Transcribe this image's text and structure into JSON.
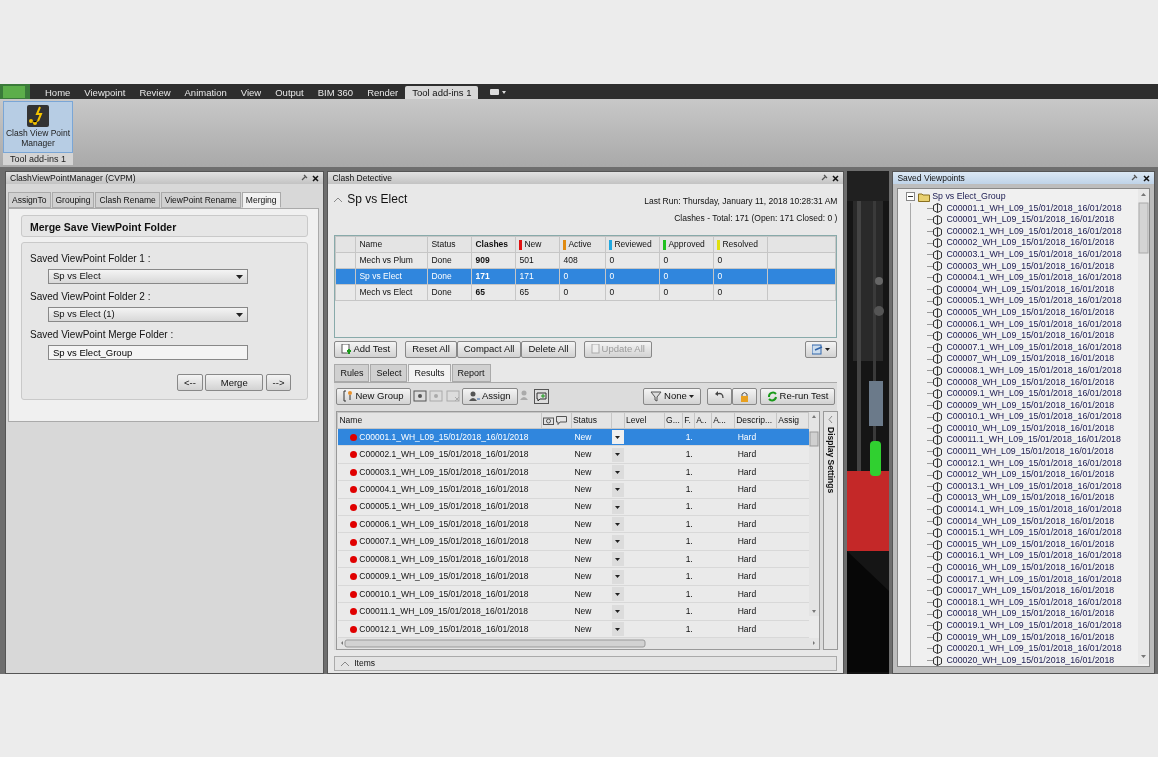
{
  "ribbon": {
    "tabs": [
      {
        "label": "Home",
        "selected": false
      },
      {
        "label": "Viewpoint",
        "selected": false
      },
      {
        "label": "Review",
        "selected": false
      },
      {
        "label": "Animation",
        "selected": false
      },
      {
        "label": "View",
        "selected": false
      },
      {
        "label": "Output",
        "selected": false
      },
      {
        "label": "BIM 360",
        "selected": false
      },
      {
        "label": "Render",
        "selected": false
      },
      {
        "label": "Tool add-ins 1",
        "selected": true
      }
    ],
    "button": {
      "label": "Clash View Point Manager",
      "selected": true
    },
    "group_label": "Tool add-ins 1"
  },
  "cvpm_panel": {
    "title": "ClashViewPointManager (CVPM)",
    "tabs": [
      {
        "label": "AssignTo",
        "selected": false
      },
      {
        "label": "Grouping",
        "selected": false
      },
      {
        "label": "Clash Rename",
        "selected": false
      },
      {
        "label": "ViewPoint Rename",
        "selected": false
      },
      {
        "label": "Merging",
        "selected": true
      }
    ],
    "heading": "Merge Save ViewPoint Folder",
    "fields": [
      {
        "kind": "select",
        "label": "Saved ViewPoint Folder 1 :",
        "value": "Sp vs Elect"
      },
      {
        "kind": "select",
        "label": "Saved ViewPoint Folder 2 :",
        "value": "Sp vs Elect (1)"
      },
      {
        "kind": "text",
        "label": "Saved ViewPoint Merge Folder :",
        "value": "Sp vs Elect_Group"
      }
    ],
    "buttons": [
      "<--",
      "Merge",
      "-->"
    ]
  },
  "clash_detective": {
    "title": "Clash Detective",
    "test_name": "Sp vs Elect",
    "last_run": "Last Run:  Thursday, January 11, 2018 10:28:31 AM",
    "summary": "Clashes - Total: 171  (Open: 171  Closed: 0 )",
    "tests_table": {
      "columns": [
        {
          "label": "Name"
        },
        {
          "label": "Status"
        },
        {
          "label": "Clashes"
        },
        {
          "label": "New",
          "color": "#e01010"
        },
        {
          "label": "Active",
          "color": "#e08a10"
        },
        {
          "label": "Reviewed",
          "color": "#20a8e0"
        },
        {
          "label": "Approved",
          "color": "#20c020"
        },
        {
          "label": "Resolved",
          "color": "#e0e010"
        }
      ],
      "rows": [
        {
          "selected": false,
          "cells": [
            "Mech vs Plum",
            "Done",
            "909",
            "501",
            "408",
            "0",
            "0",
            "0"
          ]
        },
        {
          "selected": true,
          "cells": [
            "Sp vs Elect",
            "Done",
            "171",
            "171",
            "0",
            "0",
            "0",
            "0"
          ]
        },
        {
          "selected": false,
          "cells": [
            "Mech vs Elect",
            "Done",
            "65",
            "65",
            "0",
            "0",
            "0",
            "0"
          ]
        }
      ]
    },
    "test_buttons": [
      {
        "label": "Add Test",
        "disabled": false
      },
      {
        "label": "Reset All",
        "disabled": false
      },
      {
        "label": "Compact All",
        "disabled": false
      },
      {
        "label": "Delete All",
        "disabled": false
      },
      {
        "label": "Update All",
        "disabled": true
      }
    ],
    "tabs": [
      {
        "label": "Rules",
        "selected": false
      },
      {
        "label": "Select",
        "selected": false
      },
      {
        "label": "Results",
        "selected": true
      },
      {
        "label": "Report",
        "selected": false
      }
    ],
    "results_toolbar": {
      "new_group": "New Group",
      "assign": "Assign",
      "filter": "None",
      "rerun": "Re-run Test"
    },
    "results": {
      "columns": [
        "Name",
        "Status",
        "Level",
        "G...",
        "F.",
        "A..",
        "A...",
        "Descrip...",
        "Assig"
      ],
      "rows": [
        {
          "selected": true,
          "color": "#e00000",
          "name": "C00001.1_WH_L09_15/01/2018_16/01/2018",
          "status": "New",
          "f": "1.",
          "description": "Hard"
        },
        {
          "selected": false,
          "color": "#e00000",
          "name": "C00002.1_WH_L09_15/01/2018_16/01/2018",
          "status": "New",
          "f": "1.",
          "description": "Hard"
        },
        {
          "selected": false,
          "color": "#e00000",
          "name": "C00003.1_WH_L09_15/01/2018_16/01/2018",
          "status": "New",
          "f": "1.",
          "description": "Hard"
        },
        {
          "selected": false,
          "color": "#e00000",
          "name": "C00004.1_WH_L09_15/01/2018_16/01/2018",
          "status": "New",
          "f": "1.",
          "description": "Hard"
        },
        {
          "selected": false,
          "color": "#e00000",
          "name": "C00005.1_WH_L09_15/01/2018_16/01/2018",
          "status": "New",
          "f": "1.",
          "description": "Hard"
        },
        {
          "selected": false,
          "color": "#e00000",
          "name": "C00006.1_WH_L09_15/01/2018_16/01/2018",
          "status": "New",
          "f": "1.",
          "description": "Hard"
        },
        {
          "selected": false,
          "color": "#e00000",
          "name": "C00007.1_WH_L09_15/01/2018_16/01/2018",
          "status": "New",
          "f": "1.",
          "description": "Hard"
        },
        {
          "selected": false,
          "color": "#e00000",
          "name": "C00008.1_WH_L09_15/01/2018_16/01/2018",
          "status": "New",
          "f": "1.",
          "description": "Hard"
        },
        {
          "selected": false,
          "color": "#e00000",
          "name": "C00009.1_WH_L09_15/01/2018_16/01/2018",
          "status": "New",
          "f": "1.",
          "description": "Hard"
        },
        {
          "selected": false,
          "color": "#e00000",
          "name": "C00010.1_WH_L09_15/01/2018_16/01/2018",
          "status": "New",
          "f": "1.",
          "description": "Hard"
        },
        {
          "selected": false,
          "color": "#e00000",
          "name": "C00011.1_WH_L09_15/01/2018_16/01/2018",
          "status": "New",
          "f": "1.",
          "description": "Hard"
        },
        {
          "selected": false,
          "color": "#e00000",
          "name": "C00012.1_WH_L09_15/01/2018_16/01/2018",
          "status": "New",
          "f": "1.",
          "description": "Hard"
        }
      ]
    },
    "side_tab": "Display Settings",
    "items_bar": "Items"
  },
  "saved_viewpoints": {
    "title": "Saved Viewpoints",
    "tree": [
      {
        "label": "Sp vs Elect_Group",
        "expanded": true,
        "children": [
          {
            "label": "C00001.1_WH_L09_15/01/2018_16/01/2018"
          },
          {
            "label": "C00001_WH_L09_15/01/2018_16/01/2018"
          },
          {
            "label": "C00002.1_WH_L09_15/01/2018_16/01/2018"
          },
          {
            "label": "C00002_WH_L09_15/01/2018_16/01/2018"
          },
          {
            "label": "C00003.1_WH_L09_15/01/2018_16/01/2018"
          },
          {
            "label": "C00003_WH_L09_15/01/2018_16/01/2018"
          },
          {
            "label": "C00004.1_WH_L09_15/01/2018_16/01/2018"
          },
          {
            "label": "C00004_WH_L09_15/01/2018_16/01/2018"
          },
          {
            "label": "C00005.1_WH_L09_15/01/2018_16/01/2018"
          },
          {
            "label": "C00005_WH_L09_15/01/2018_16/01/2018"
          },
          {
            "label": "C00006.1_WH_L09_15/01/2018_16/01/2018"
          },
          {
            "label": "C00006_WH_L09_15/01/2018_16/01/2018"
          },
          {
            "label": "C00007.1_WH_L09_15/01/2018_16/01/2018"
          },
          {
            "label": "C00007_WH_L09_15/01/2018_16/01/2018"
          },
          {
            "label": "C00008.1_WH_L09_15/01/2018_16/01/2018"
          },
          {
            "label": "C00008_WH_L09_15/01/2018_16/01/2018"
          },
          {
            "label": "C00009.1_WH_L09_15/01/2018_16/01/2018"
          },
          {
            "label": "C00009_WH_L09_15/01/2018_16/01/2018"
          },
          {
            "label": "C00010.1_WH_L09_15/01/2018_16/01/2018"
          },
          {
            "label": "C00010_WH_L09_15/01/2018_16/01/2018"
          },
          {
            "label": "C00011.1_WH_L09_15/01/2018_16/01/2018"
          },
          {
            "label": "C00011_WH_L09_15/01/2018_16/01/2018"
          },
          {
            "label": "C00012.1_WH_L09_15/01/2018_16/01/2018"
          },
          {
            "label": "C00012_WH_L09_15/01/2018_16/01/2018"
          },
          {
            "label": "C00013.1_WH_L09_15/01/2018_16/01/2018"
          },
          {
            "label": "C00013_WH_L09_15/01/2018_16/01/2018"
          },
          {
            "label": "C00014.1_WH_L09_15/01/2018_16/01/2018"
          },
          {
            "label": "C00014_WH_L09_15/01/2018_16/01/2018"
          },
          {
            "label": "C00015.1_WH_L09_15/01/2018_16/01/2018"
          },
          {
            "label": "C00015_WH_L09_15/01/2018_16/01/2018"
          },
          {
            "label": "C00016.1_WH_L09_15/01/2018_16/01/2018"
          },
          {
            "label": "C00016_WH_L09_15/01/2018_16/01/2018"
          },
          {
            "label": "C00017.1_WH_L09_15/01/2018_16/01/2018"
          },
          {
            "label": "C00017_WH_L09_15/01/2018_16/01/2018"
          },
          {
            "label": "C00018.1_WH_L09_15/01/2018_16/01/2018"
          },
          {
            "label": "C00018_WH_L09_15/01/2018_16/01/2018"
          },
          {
            "label": "C00019.1_WH_L09_15/01/2018_16/01/2018"
          },
          {
            "label": "C00019_WH_L09_15/01/2018_16/01/2018"
          },
          {
            "label": "C00020.1_WH_L09_15/01/2018_16/01/2018"
          },
          {
            "label": "C00020_WH_L09_15/01/2018_16/01/2018"
          }
        ]
      }
    ]
  }
}
